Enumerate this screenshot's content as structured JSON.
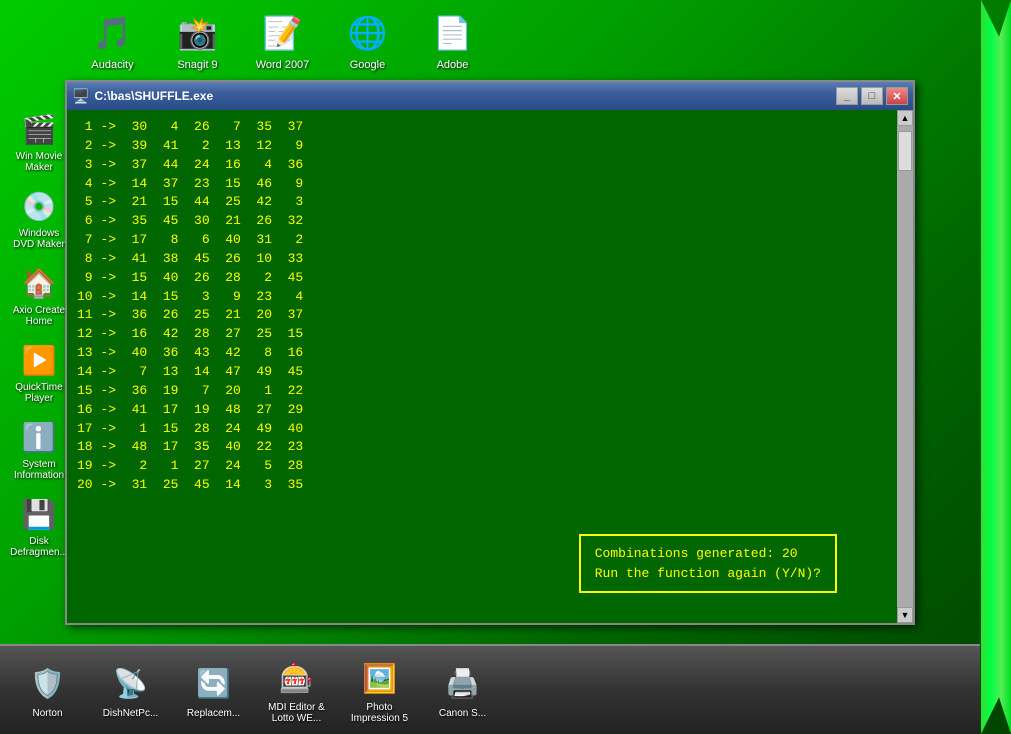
{
  "desktop": {
    "background": "#006600"
  },
  "top_icons": [
    {
      "id": "audacity",
      "label": "Audacity",
      "emoji": "🎵"
    },
    {
      "id": "snagit9",
      "label": "Snagit 9",
      "emoji": "📸"
    },
    {
      "id": "word2007",
      "label": "Word 2007",
      "emoji": "📝"
    },
    {
      "id": "google",
      "label": "Google",
      "emoji": "🌐"
    },
    {
      "id": "adobe",
      "label": "Adobe",
      "emoji": "📄"
    }
  ],
  "left_icons": [
    {
      "id": "win-movie-maker",
      "label": "Win Movie Maker",
      "emoji": "🎬"
    },
    {
      "id": "windows-dvd",
      "label": "Windows DVD Maker",
      "emoji": "💿"
    },
    {
      "id": "axio-create",
      "label": "Axio Create Home",
      "emoji": "🏠"
    },
    {
      "id": "quicktime",
      "label": "QuickTime Player",
      "emoji": "▶️"
    },
    {
      "id": "system-info",
      "label": "System Information",
      "emoji": "ℹ️"
    },
    {
      "id": "disk-defrag",
      "label": "Disk Defragmenter",
      "emoji": "💾"
    }
  ],
  "taskbar_icons": [
    {
      "id": "norton",
      "label": "Norton",
      "emoji": "🛡️"
    },
    {
      "id": "dishnetpc",
      "label": "DishNetPc...",
      "emoji": "📡"
    },
    {
      "id": "replacem",
      "label": "Replacem...",
      "emoji": "🔄"
    },
    {
      "id": "mdi-editor",
      "label": "MDI Editor & Lotto WE...",
      "emoji": "🎰"
    },
    {
      "id": "photo",
      "label": "Photo Impression 5",
      "emoji": "🖼️"
    },
    {
      "id": "canon",
      "label": "Canon S...",
      "emoji": "🖨️"
    }
  ],
  "window": {
    "title": "C:\\bas\\SHUFFLE.exe",
    "title_icon": "🖥️",
    "min_label": "_",
    "max_label": "□",
    "close_label": "✕"
  },
  "console": {
    "lines": [
      " 1 ->  30   4  26   7  35  37",
      " 2 ->  39  41   2  13  12   9",
      " 3 ->  37  44  24  16   4  36",
      " 4 ->  14  37  23  15  46   9",
      " 5 ->  21  15  44  25  42   3",
      " 6 ->  35  45  30  21  26  32",
      " 7 ->  17   8   6  40  31   2",
      " 8 ->  41  38  45  26  10  33",
      " 9 ->  15  40  26  28   2  45",
      "10 ->  14  15   3   9  23   4",
      "11 ->  36  26  25  21  20  37",
      "12 ->  16  42  28  27  25  15",
      "13 ->  40  36  43  42   8  16",
      "14 ->   7  13  14  47  49  45",
      "15 ->  36  19   7  20   1  22",
      "16 ->  41  17  19  48  27  29",
      "17 ->   1  15  28  24  49  40",
      "18 ->  48  17  35  40  22  23",
      "19 ->   2   1  27  24   5  28",
      "20 ->  31  25  45  14   3  35"
    ],
    "prompt_line1": "Combinations generated:  20",
    "prompt_line2": "Run the function again (Y/N)?"
  }
}
